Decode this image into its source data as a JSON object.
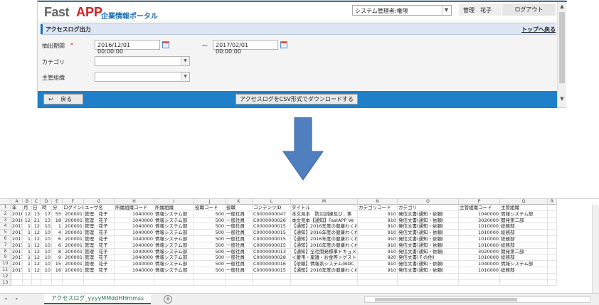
{
  "app": {
    "logo_fast": "Fast",
    "logo_app": "APP",
    "logo_portal": "企業情報ポータル",
    "role_select": "システム管理者:権限",
    "user_name": "管理　花子",
    "logout": "ログアウト",
    "page_title": "アクセスログ出力",
    "back_to_top": "トップへ戻る",
    "form": {
      "period_label": "抽出期間",
      "required_mark": "*",
      "date_from": "2016/12/01 00:00:00",
      "tilde": "～",
      "date_to": "2017/02/01 00:00:00",
      "category_label": "カテゴリ",
      "category_value": "",
      "org_label": "主管組織",
      "org_value": ""
    },
    "back_button": "戻る",
    "back_icon": "↩",
    "csv_button": "アクセスログをCSV形式でダウンロードする"
  },
  "arrow_color": "#4f7fbf",
  "spreadsheet": {
    "column_letters": [
      "A",
      "B",
      "C",
      "D",
      "E",
      "F",
      "G",
      "H",
      "I",
      "J",
      "K",
      "L",
      "M",
      "N",
      "O",
      "P",
      "Q",
      "R"
    ],
    "row_numbers": [
      "1",
      "2",
      "3",
      "4",
      "5",
      "6",
      "7",
      "8",
      "9",
      "10",
      "11",
      "12",
      "13"
    ],
    "headers": [
      "年",
      "月",
      "日",
      "時",
      "分",
      "ログインID",
      "ユーザ名",
      "所属組織コード",
      "所属組織",
      "役職コード",
      "役職",
      "コンテンツID",
      "タイトル",
      "カテゴリコード",
      "カテゴリ",
      "主管組織コード",
      "主管組織"
    ],
    "rows": [
      [
        "2016",
        "12",
        "13",
        "17",
        "55",
        "200001",
        "管理　花子",
        "1040000",
        "情報システム部",
        "500",
        "一般社員",
        "C0000000047",
        "本文見本　防災訓練及び...事",
        "910",
        "発信文書(通知・依頼)",
        "1040000",
        "情報システム部"
      ],
      [
        "2016",
        "12",
        "21",
        "13",
        "18",
        "200001",
        "管理　花子",
        "1040000",
        "情報システム部",
        "500",
        "一般社員",
        "C0000000026",
        "本文見本【通知】FastAPP Ve",
        "910",
        "発信文書(通知・依頼)",
        "3020000",
        "開発第二部"
      ],
      [
        "2017",
        "1",
        "12",
        "10",
        "1",
        "200001",
        "管理　花子",
        "1040000",
        "情報システム部",
        "500",
        "一般社員",
        "C0000000015",
        "【通知】2016年度の健康わくわ",
        "910",
        "発信文書(通知・依頼)",
        "1010000",
        "総務部"
      ],
      [
        "2017",
        "1",
        "12",
        "10",
        "4",
        "200001",
        "管理　花子",
        "1040000",
        "情報システム部",
        "500",
        "一般社員",
        "C0000000015",
        "【通知】2016年度の健康わくわ",
        "910",
        "発信文書(通知・依頼)",
        "1010000",
        "総務部"
      ],
      [
        "2017",
        "1",
        "12",
        "10",
        "6",
        "200001",
        "管理　花子",
        "1040000",
        "情報システム部",
        "500",
        "一般社員",
        "C0000000015",
        "【通知】2016年度の健康わくわ",
        "910",
        "発信文書(通知・依頼)",
        "1010000",
        "総務部"
      ],
      [
        "2017",
        "1",
        "12",
        "10",
        "6",
        "200001",
        "管理　花子",
        "1040000",
        "情報システム部",
        "500",
        "一般社員",
        "C0000000015",
        "【通知】2016年度の健康わくわ",
        "910",
        "発信文書(通知・依頼)",
        "1010000",
        "総務部"
      ],
      [
        "2017",
        "1",
        "12",
        "10",
        "8",
        "200001",
        "管理　花子",
        "1040000",
        "情報システム部",
        "500",
        "一般社員",
        "C0000000013",
        "【通知】全社開発標準ドキュメ",
        "910",
        "発信文書(通知・依頼)",
        "3020000",
        "開発第二部"
      ],
      [
        "2017",
        "1",
        "12",
        "10",
        "9",
        "200001",
        "管理　花子",
        "1040000",
        "情報システム部",
        "500",
        "一般社員",
        "C0000000028",
        "＜慶弔・稟議・お金等＞ゲスト",
        "920",
        "発信文書(その他)",
        "1010000",
        "総務部"
      ],
      [
        "2017",
        "1",
        "12",
        "10",
        "15",
        "200001",
        "管理　花子",
        "1040000",
        "情報システム部",
        "500",
        "一般社員",
        "C0000000016",
        "【依頼】情報系システム(BDC",
        "910",
        "発信文書(通知・依頼)",
        "1040000",
        "情報システム部"
      ],
      [
        "2017",
        "1",
        "12",
        "10",
        "16",
        "200001",
        "管理　花子",
        "1040000",
        "情報システム部",
        "500",
        "一般社員",
        "C0000000015",
        "【通知】2016年度の健康わくわ",
        "910",
        "発信文書(通知・依頼)",
        "1010000",
        "総務部"
      ]
    ],
    "sheet_tab": "アクセスログ_yyyyMMddHHmmss",
    "add_sheet": "+",
    "nav_prev": "◂",
    "nav_next": "▸"
  }
}
